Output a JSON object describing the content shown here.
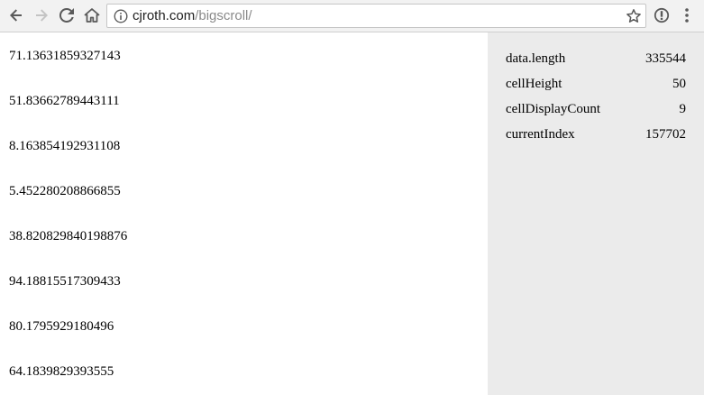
{
  "browser": {
    "url_domain": "cjroth.com",
    "url_path": "/bigscroll/",
    "icons": [
      "back-icon",
      "forward-icon",
      "reload-icon",
      "home-icon",
      "info-icon",
      "star-icon",
      "extension-icon",
      "menu-icon"
    ]
  },
  "list": {
    "items": [
      "71.13631859327143",
      "51.83662789443111",
      "8.163854192931108",
      "5.452280208866855",
      "38.820829840198876",
      "94.18815517309433",
      "80.1795929180496",
      "64.1839829393555"
    ]
  },
  "stats": [
    {
      "label": "data.length",
      "value": "335544"
    },
    {
      "label": "cellHeight",
      "value": "50"
    },
    {
      "label": "cellDisplayCount",
      "value": "9"
    },
    {
      "label": "currentIndex",
      "value": "157702"
    }
  ],
  "colors": {
    "sidebar_bg": "#ebebeb",
    "toolbar_bg": "#f2f2f2"
  }
}
